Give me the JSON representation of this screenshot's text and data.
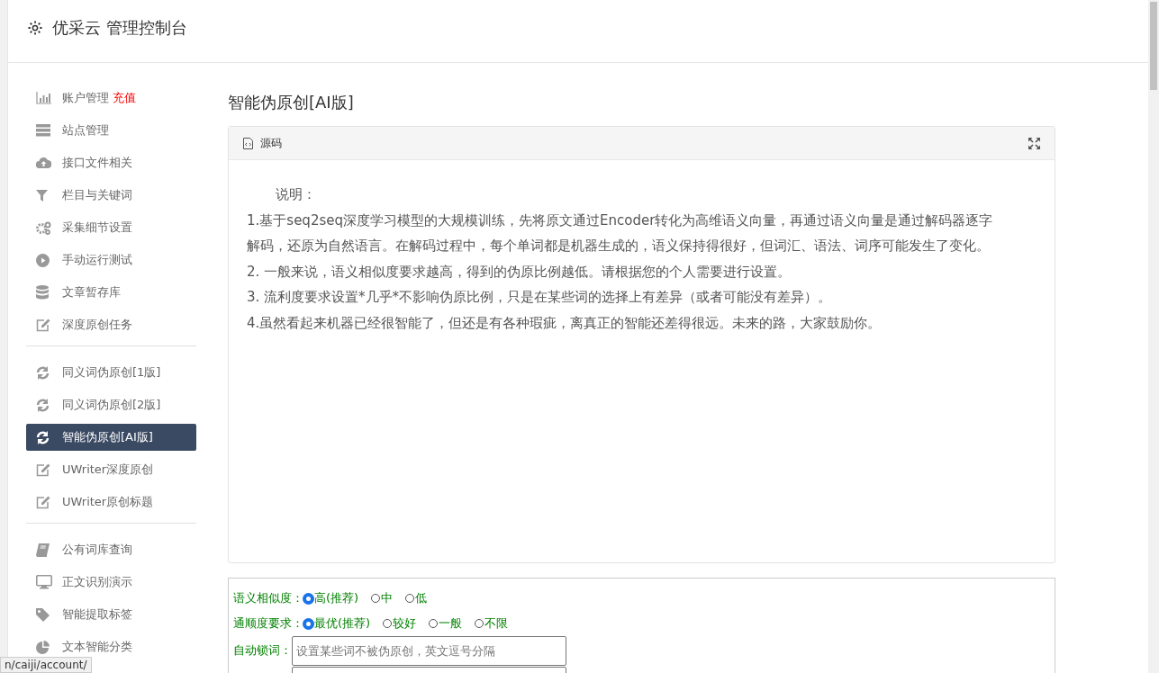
{
  "header": {
    "title": "优采云 管理控制台"
  },
  "sidebar": {
    "groups": [
      {
        "items": [
          {
            "kind": "chart",
            "label": "账户管理",
            "badge": "充值",
            "selected": false
          },
          {
            "kind": "server",
            "label": "站点管理",
            "selected": false
          },
          {
            "kind": "cloud",
            "label": "接口文件相关",
            "selected": false
          },
          {
            "kind": "filter",
            "label": "栏目与关键词",
            "selected": false
          },
          {
            "kind": "gears",
            "label": "采集细节设置",
            "selected": false
          },
          {
            "kind": "play",
            "label": "手动运行测试",
            "selected": false
          },
          {
            "kind": "database",
            "label": "文章暂存库",
            "selected": false
          },
          {
            "kind": "edit",
            "label": "深度原创任务",
            "selected": false
          }
        ]
      },
      {
        "items": [
          {
            "kind": "refresh",
            "label": "同义词伪原创[1版]",
            "selected": false
          },
          {
            "kind": "refresh",
            "label": "同义词伪原创[2版]",
            "selected": false
          },
          {
            "kind": "refresh",
            "label": "智能伪原创[AI版]",
            "selected": true
          },
          {
            "kind": "edit",
            "label": "UWriter深度原创",
            "selected": false
          },
          {
            "kind": "edit",
            "label": "UWriter原创标题",
            "selected": false
          }
        ]
      },
      {
        "items": [
          {
            "kind": "book",
            "label": "公有词库查询",
            "selected": false
          },
          {
            "kind": "monitor",
            "label": "正文识别演示",
            "selected": false
          },
          {
            "kind": "tag",
            "label": "智能提取标签",
            "selected": false
          },
          {
            "kind": "pie",
            "label": "文本智能分类",
            "selected": false
          }
        ]
      }
    ]
  },
  "page": {
    "title": "智能伪原创[AI版]"
  },
  "source_panel": {
    "title": "源码",
    "lines": [
      "说明：",
      "1.基于seq2seq深度学习模型的大规模训练，先将原文通过Encoder转化为高维语义向量，再通过语义向量是通过解码器逐字解码，还原为自然语言。在解码过程中，每个单词都是机器生成的，语义保持得很好，但词汇、语法、词序可能发生了变化。",
      "2. 一般来说，语义相似度要求越高，得到的伪原比例越低。请根据您的个人需要进行设置。",
      "3. 流利度要求设置*几乎*不影响伪原比例，只是在某些词的选择上有差异（或者可能没有差异）。",
      "4.虽然看起来机器已经很智能了，但还是有各种瑕疵，离真正的智能还差得很远。未来的路，大家鼓励你。"
    ]
  },
  "options": {
    "rows": [
      {
        "kind": "radio",
        "label": "语义相似度：",
        "choices": [
          {
            "label": "高(推荐)",
            "selected": true
          },
          {
            "label": "中",
            "selected": false
          },
          {
            "label": "低",
            "selected": false
          }
        ]
      },
      {
        "kind": "radio",
        "label": "通顺度要求：",
        "choices": [
          {
            "label": "最优(推荐)",
            "selected": true
          },
          {
            "label": "较好",
            "selected": false
          },
          {
            "label": "一般",
            "selected": false
          },
          {
            "label": "不限",
            "selected": false
          }
        ]
      },
      {
        "kind": "text",
        "label": "自动锁词：",
        "placeholder": "设置某些词不被伪原创，英文逗号分隔"
      }
    ]
  },
  "status_bar": {
    "url": "n/caiji/account/"
  }
}
